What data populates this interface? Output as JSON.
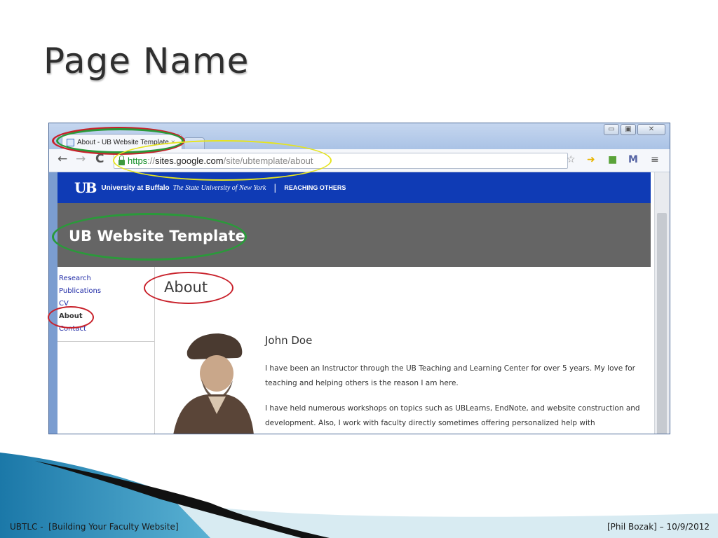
{
  "slide": {
    "title": "Page Name",
    "footer_left": "UBTLC -  [Building Your Faculty Website]",
    "footer_right": "[Phil Bozak] – 10/9/2012"
  },
  "browser": {
    "tab_title": "About - UB Website Template",
    "tab_close": "×",
    "window_buttons": {
      "minimize": "▭",
      "maximize": "▣",
      "close": "✕"
    },
    "nav": {
      "back": "←",
      "forward": "→",
      "reload": "C"
    },
    "address": {
      "scheme": "https",
      "separator": "://",
      "host": "sites.google.com",
      "path": "/site/ubtemplate/about"
    },
    "toolbar_icons": [
      "star-icon",
      "extension-icon",
      "evernote-icon",
      "gmail-icon",
      "menu-icon"
    ]
  },
  "site": {
    "banner": {
      "logo": "UB",
      "name": "University at Buffalo",
      "subtitle": "The State University of New York",
      "divider": "|",
      "tagline": "REACHING OTHERS"
    },
    "title": "UB Website Template",
    "nav_items": [
      "Research",
      "Publications",
      "CV",
      "About",
      "Contact"
    ],
    "current_nav": "About",
    "page_heading": "About",
    "person_name": "John Doe",
    "bio_paragraphs": [
      "I have been an Instructor through the UB Teaching and Learning Center for over 5 years. My love for teaching and helping others is the reason I am here.",
      "I have held numerous workshops on topics such as UBLearns, EndNote, and website construction and development. Also, I work with faculty directly sometimes offering personalized help with"
    ]
  },
  "colors": {
    "ub_blue": "#0f3bb5",
    "header_gray": "#656565",
    "annotation_red": "#c8202a",
    "annotation_green": "#2a9a3a",
    "annotation_yellow": "#e6e41e"
  }
}
